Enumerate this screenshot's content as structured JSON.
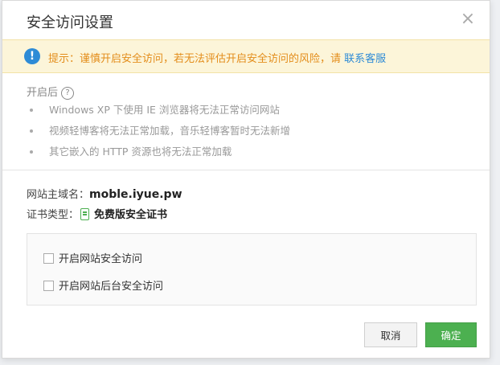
{
  "dialog": {
    "title": "安全访问设置",
    "close_icon": "×"
  },
  "notice": {
    "icon": "!",
    "text": "提示：谨慎开启安全访问，若无法评估开启安全访问的风险，请 ",
    "link": "联系客服"
  },
  "info": {
    "title": "开启后",
    "help_icon": "?",
    "bullets": [
      "Windows XP 下使用 IE 浏览器将无法正常访问网站",
      "视频轻博客将无法正常加载，音乐轻博客暂时无法新增",
      "其它嵌入的 HTTP 资源也将无法正常加载"
    ]
  },
  "domain": {
    "label": "网站主域名：",
    "value": "moble.iyue.pw"
  },
  "cert": {
    "label": "证书类型：",
    "value": "免费版安全证书"
  },
  "options": [
    {
      "label": "开启网站安全访问",
      "checked": false
    },
    {
      "label": "开启网站后台安全访问",
      "checked": false
    }
  ],
  "buttons": {
    "cancel": "取消",
    "ok": "确定"
  },
  "colors": {
    "accent_green": "#4cb050",
    "link_blue": "#2e8bd6",
    "warning_orange": "#e38d1b",
    "notice_bg": "#fcf5d9"
  }
}
